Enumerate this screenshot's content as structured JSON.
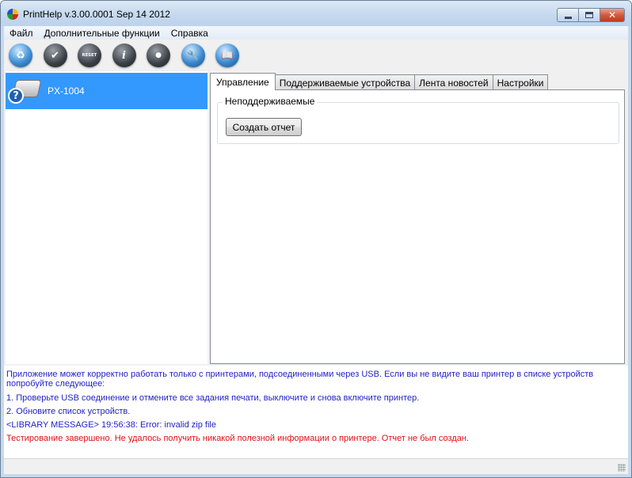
{
  "window": {
    "title": "PrintHelp v.3.00.0001 Sep 14 2012",
    "controls": {
      "minimize": "minimize",
      "maximize": "maximize",
      "close": "✕"
    }
  },
  "menu": {
    "items": [
      {
        "label": "Файл"
      },
      {
        "label": "Дополнительные функции"
      },
      {
        "label": "Справка"
      }
    ]
  },
  "toolbar": {
    "buttons": [
      {
        "icon": "refresh-recycle-icon",
        "glyph": "♻"
      },
      {
        "icon": "check-icon",
        "glyph": "✔"
      },
      {
        "icon": "reset-icon",
        "glyph": "RESET"
      },
      {
        "icon": "info-icon",
        "glyph": "i"
      },
      {
        "icon": "disc-icon",
        "glyph": "●"
      },
      {
        "icon": "wrench-icon",
        "glyph": "🔧"
      },
      {
        "icon": "book-icon",
        "glyph": "📖"
      }
    ]
  },
  "devices": [
    {
      "name": "PX-1004",
      "selected": true
    }
  ],
  "tabs": [
    {
      "label": "Управление",
      "active": true
    },
    {
      "label": "Поддерживаемые устройства",
      "active": false
    },
    {
      "label": "Лента новостей",
      "active": false
    },
    {
      "label": "Настройки",
      "active": false
    }
  ],
  "panel": {
    "group_title": "Неподдерживаемые",
    "create_report_label": "Создать отчет"
  },
  "log": {
    "lines": [
      {
        "text": "Приложение может корректно работать только с принтерами, подсоединенными через USB. Если вы не видите ваш принтер в списке устройств попробуйте следующее:",
        "color": "blue"
      },
      {
        "text": "1. Проверьте USB соединение и отмените все задания печати, выключите и снова включите принтер.",
        "color": "blue"
      },
      {
        "text": "2. Обновите список устройств.",
        "color": "blue"
      },
      {
        "text": "<LIBRARY MESSAGE> 19:56:38: Error: invalid zip file",
        "color": "blue"
      },
      {
        "text": "Тестирование завершено. Не удалось получить никакой полезной информации о принтере. Отчет не был создан.",
        "color": "red"
      }
    ]
  },
  "colors": {
    "selection": "#3399ff",
    "log_blue": "#1e1ec8",
    "log_red": "#e01010"
  }
}
